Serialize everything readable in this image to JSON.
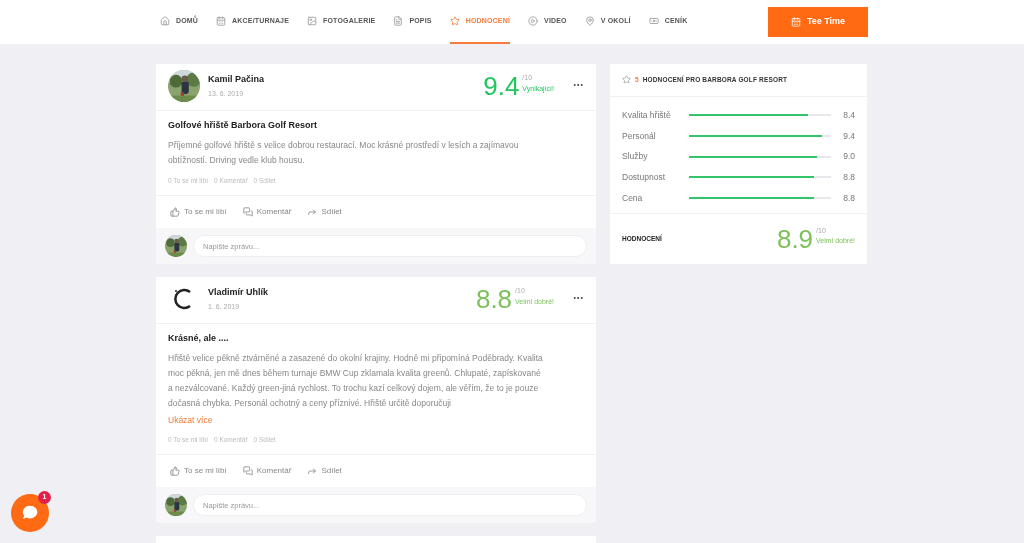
{
  "nav": {
    "items": [
      {
        "label": "DOMŮ",
        "selected": false
      },
      {
        "label": "AKCE/TURNAJE",
        "selected": false
      },
      {
        "label": "FOTOGALERIE",
        "selected": false
      },
      {
        "label": "POPIS",
        "selected": false
      },
      {
        "label": "HODNOCENÍ",
        "selected": true
      },
      {
        "label": "VIDEO",
        "selected": false
      },
      {
        "label": "V OKOLÍ",
        "selected": false
      },
      {
        "label": "CENÍK",
        "selected": false
      }
    ],
    "button": "Tee Time"
  },
  "reviews": [
    {
      "author": "Kamil Pačina",
      "date": "13. 6. 2019",
      "score": "9.4",
      "out_of": "/10",
      "verdict": "Vynikající!",
      "color": "#22c55e",
      "title": "Golfové hřiště Barbora Golf Resort",
      "text": "Příjemné golfové hřiště s velice dobrou restaurací. Moc krásné prostředí v lesích a zajímavou obtížností. Driving vedle klub housu.",
      "stats": [
        "0 To se mi líbí",
        "0 Komentář",
        "0 Sdílet"
      ],
      "actions": [
        "To se mi líbí",
        "Komentář",
        "Sdílet"
      ],
      "placeholder": "Napište zprávu..."
    },
    {
      "author": "Vladimír Uhlík",
      "date": "1. 6. 2019",
      "score": "8.8",
      "out_of": "/10",
      "verdict": "Velmi dobré!",
      "color": "#7cc15a",
      "title": "Krásné, ale ....",
      "text": "Hřiště velice pěkně ztvárněné a zasazené do okolní krajiny. Hodně mi připomíná Poděbrady. Kvalita moc pěkná, jen mě dnes během turnaje BMW Cup zklamala kvalita greenů. Chlupaté, zapískované a nezválcované. Každý green-jiná rychlost. To trochu kazí celkový dojem, ale věřím, že to je pouze dočasná chybka. Personál ochotný a ceny příznivé. Hřiště určitě doporučuji",
      "more": "Ukázat více",
      "stats": [
        "0 To se mi líbí",
        "0 Komentář",
        "0 Sdílet"
      ],
      "actions": [
        "To se mi líbí",
        "Komentář",
        "Sdílet"
      ],
      "placeholder": "Napište zprávu..."
    }
  ],
  "summary": {
    "count": "5",
    "heading": "HODNOCENÍ PRO BARBORA GOLF RESORT",
    "rows": [
      {
        "label": "Kvalita hřiště",
        "level": 0.84,
        "value": "8.4"
      },
      {
        "label": "Personál",
        "level": 0.94,
        "value": "9.4"
      },
      {
        "label": "Služby",
        "level": 0.9,
        "value": "9.0"
      },
      {
        "label": "Dostupnost",
        "level": 0.88,
        "value": "8.8"
      },
      {
        "label": "Cena",
        "level": 0.88,
        "value": "8.8"
      }
    ],
    "total_label": "HODNOCENÍ",
    "score": "8.9",
    "out_of": "/10",
    "verdict": "Velmi dobré!",
    "color": "#7cc15a"
  },
  "chat": {
    "badge": "1"
  }
}
